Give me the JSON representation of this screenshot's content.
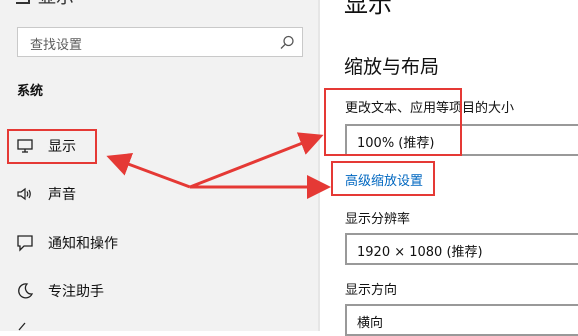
{
  "window": {
    "top_clipped_text": "显示"
  },
  "sidebar": {
    "search_placeholder": "查找设置",
    "section_label": "系统",
    "items": [
      {
        "label": "显示",
        "icon": "monitor-icon"
      },
      {
        "label": "声音",
        "icon": "speaker-icon"
      },
      {
        "label": "通知和操作",
        "icon": "message-icon"
      },
      {
        "label": "专注助手",
        "icon": "moon-icon"
      }
    ]
  },
  "main": {
    "page_title": "显示",
    "section_title": "缩放与布局",
    "scale_label": "更改文本、应用等项目的大小",
    "scale_value": "100% (推荐)",
    "advanced_link": "高级缩放设置",
    "resolution_label": "显示分辨率",
    "resolution_value": "1920 × 1080 (推荐)",
    "orientation_label": "显示方向",
    "orientation_value": "横向"
  },
  "colors": {
    "highlight": "#e53935",
    "link": "#0067c0",
    "sidebar_bg": "#f2f2f2"
  }
}
